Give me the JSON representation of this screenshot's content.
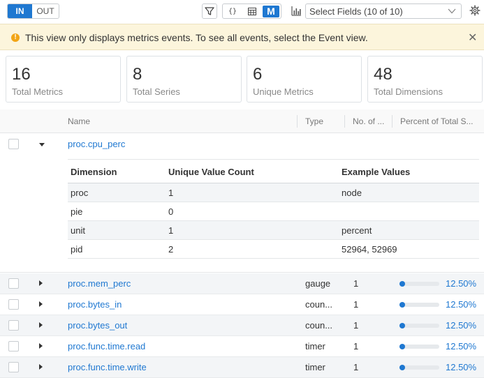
{
  "toolbar": {
    "in_label": "IN",
    "out_label": "OUT",
    "json_label": "{}",
    "m_label": "M",
    "select_fields": "Select Fields (10 of 10)",
    "icons": [
      "filter-icon",
      "json-view-icon",
      "table-view-icon",
      "bar-chart-icon",
      "chevron-down-icon",
      "gear-icon"
    ]
  },
  "banner": {
    "icon": "!",
    "message": "This view only displays metrics events. To see all events, select the Event view.",
    "close": "✕"
  },
  "stats": [
    {
      "value": "16",
      "label": "Total Metrics"
    },
    {
      "value": "8",
      "label": "Total Series"
    },
    {
      "value": "6",
      "label": "Unique Metrics"
    },
    {
      "value": "48",
      "label": "Total Dimensions"
    }
  ],
  "table": {
    "columns": [
      "Name",
      "Type",
      "No. of ...",
      "Percent of Total S..."
    ],
    "expanded_row": {
      "name": "proc.cpu_perc",
      "dim_columns": [
        "Dimension",
        "Unique Value Count",
        "Example Values"
      ],
      "dimensions": [
        {
          "dimension": "proc",
          "count": "1",
          "examples": "node"
        },
        {
          "dimension": "pie",
          "count": "0",
          "examples": ""
        },
        {
          "dimension": "unit",
          "count": "1",
          "examples": "percent"
        },
        {
          "dimension": "pid",
          "count": "2",
          "examples": "52964, 52969"
        }
      ]
    },
    "rows": [
      {
        "name": "proc.mem_perc",
        "type": "gauge",
        "count": "1",
        "percent": "12.50%",
        "fraction": 0.125
      },
      {
        "name": "proc.bytes_in",
        "type": "coun...",
        "count": "1",
        "percent": "12.50%",
        "fraction": 0.125
      },
      {
        "name": "proc.bytes_out",
        "type": "coun...",
        "count": "1",
        "percent": "12.50%",
        "fraction": 0.125
      },
      {
        "name": "proc.func.time.read",
        "type": "timer",
        "count": "1",
        "percent": "12.50%",
        "fraction": 0.125
      },
      {
        "name": "proc.func.time.write",
        "type": "timer",
        "count": "1",
        "percent": "12.50%",
        "fraction": 0.125
      }
    ]
  },
  "colors": {
    "accent": "#1f78d1",
    "banner_bg": "#fcf5dc",
    "warning": "#f2a516"
  }
}
